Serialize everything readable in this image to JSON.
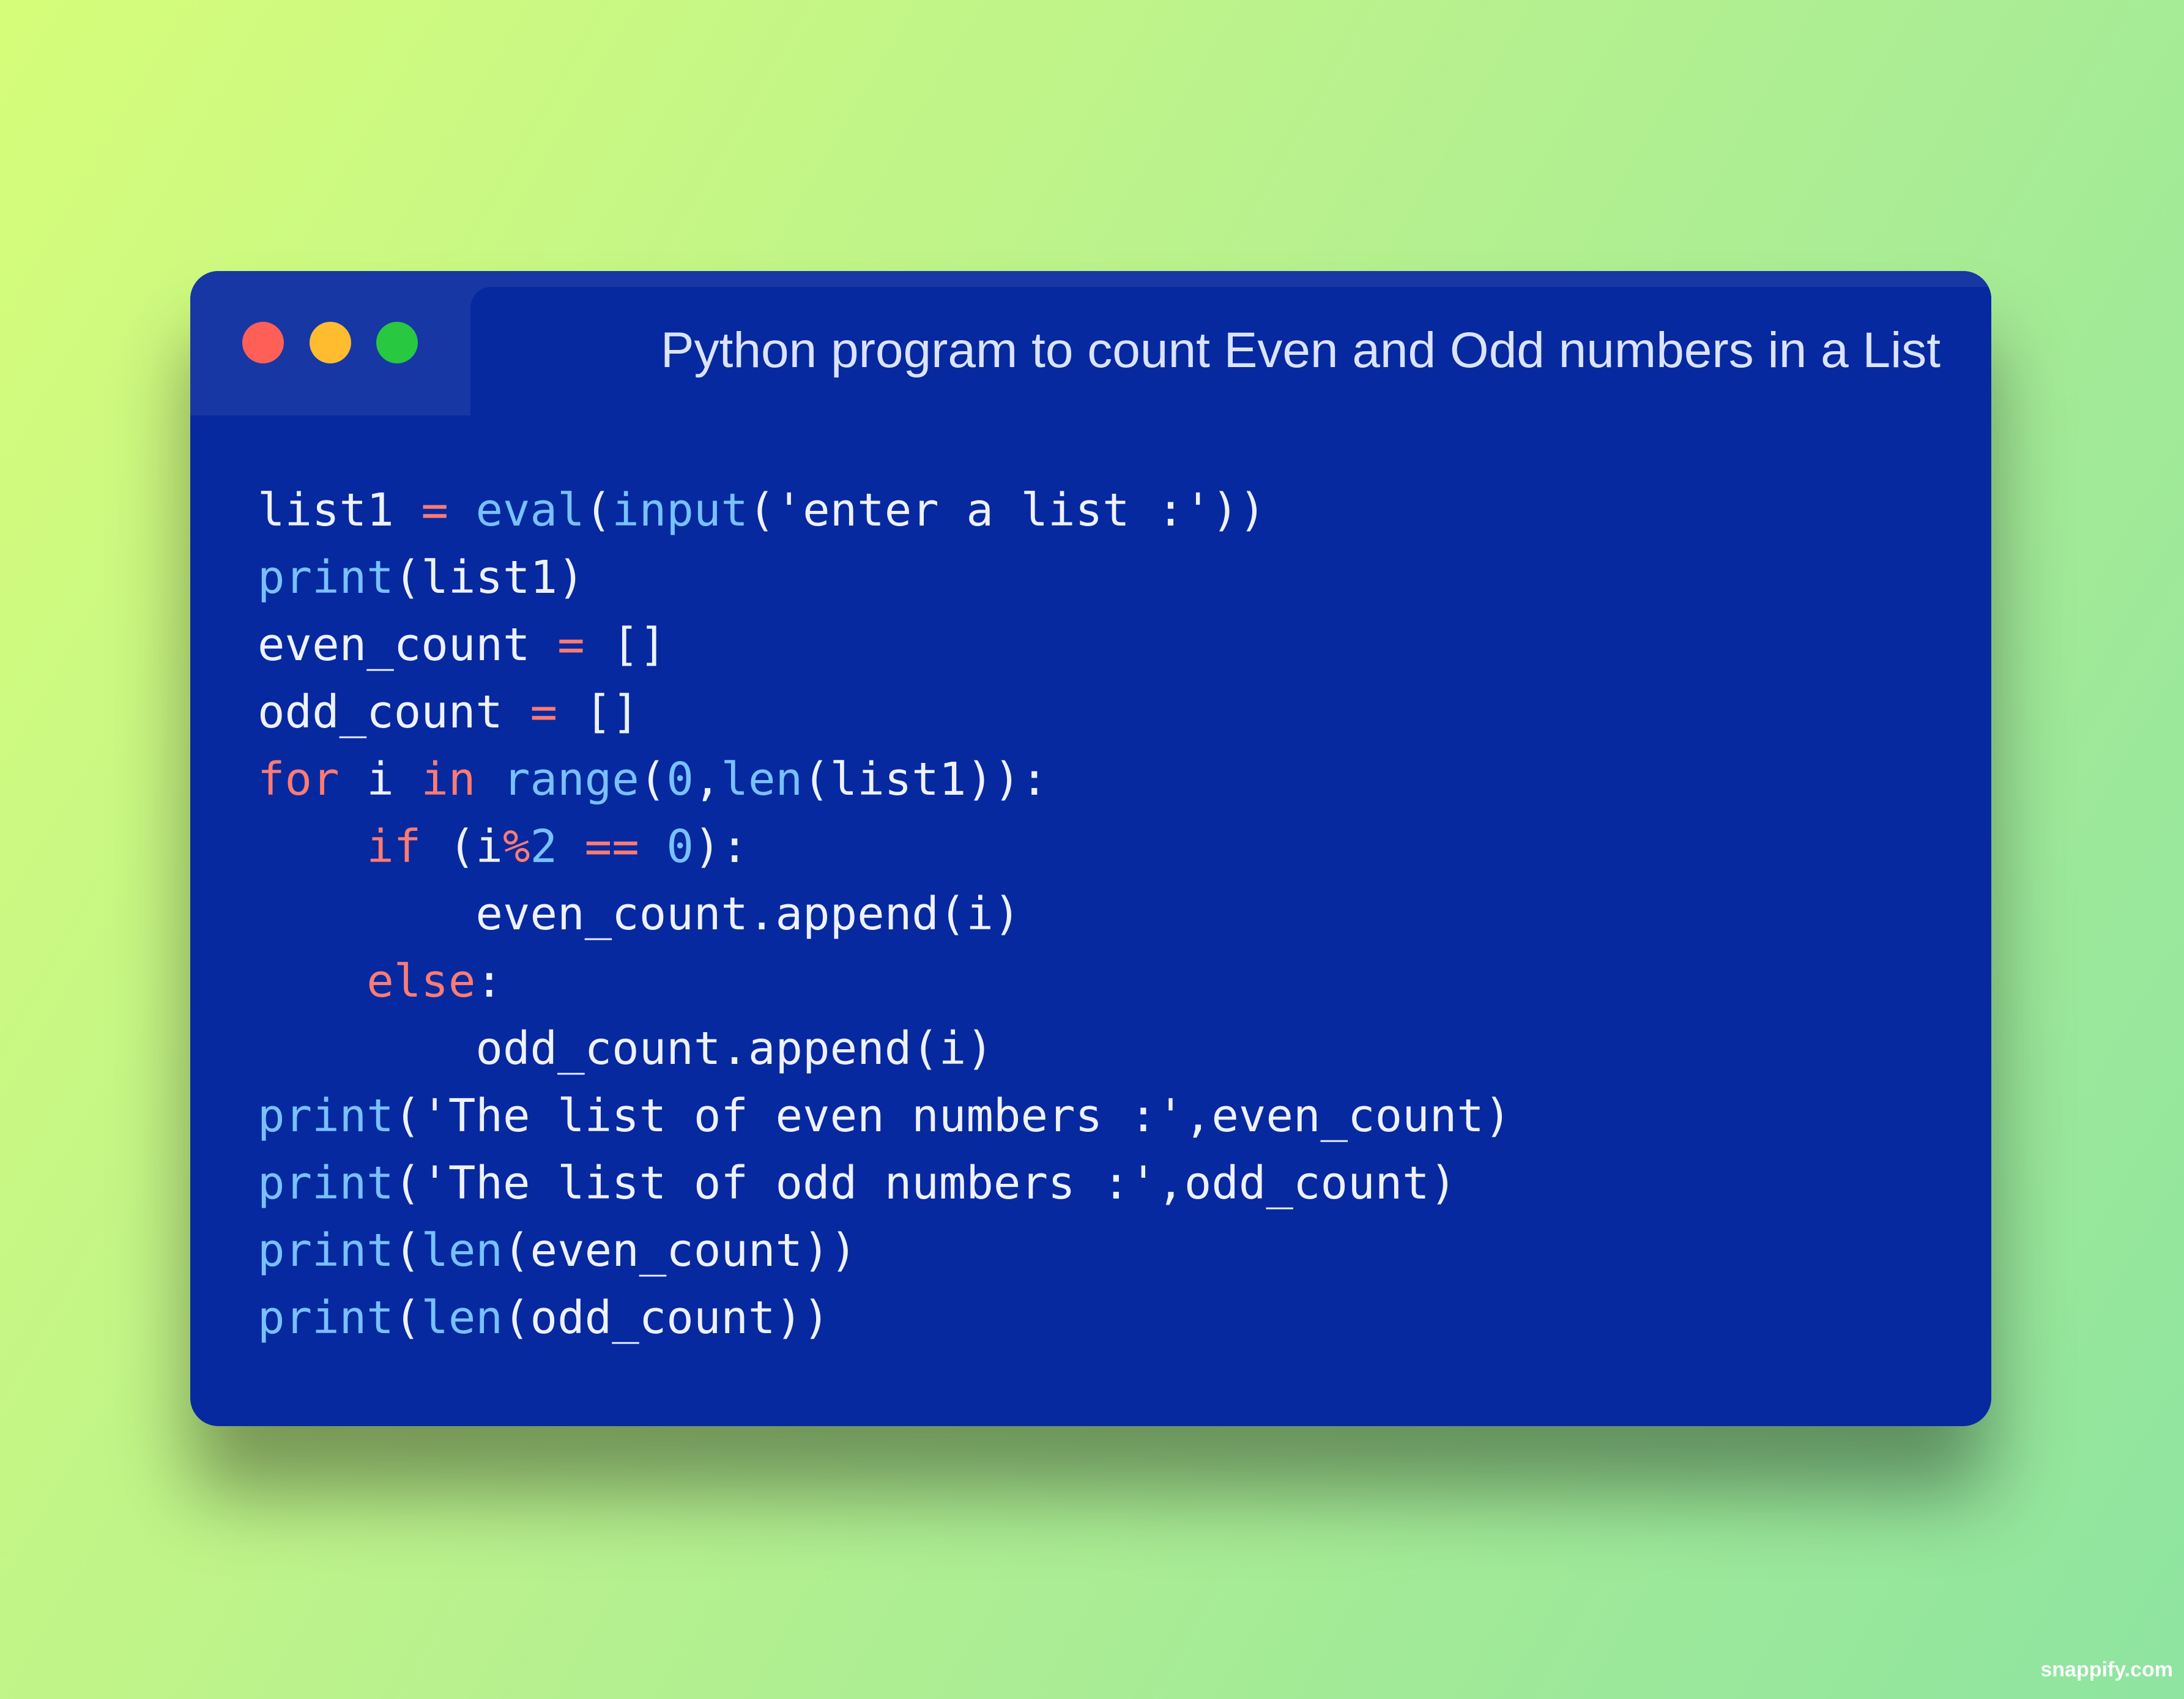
{
  "window": {
    "title": "Python program to count Even and Odd numbers in a List"
  },
  "traffic_lights": {
    "close_color": "#ff5f57",
    "minimize_color": "#febc2e",
    "maximize_color": "#28c840"
  },
  "theme": {
    "background_start": "#d6fd7a",
    "background_end": "#8ee4a0",
    "window_background": "#0629a0",
    "titlebar_background": "#1737a5",
    "builtin_color": "#79c0ff",
    "keyword_color": "#ff7b72",
    "text_color": "#eef1ff"
  },
  "code": {
    "language": "Python",
    "lines": [
      [
        {
          "t": "list1 ",
          "k": "plain"
        },
        {
          "t": "=",
          "k": "op"
        },
        {
          "t": " ",
          "k": "plain"
        },
        {
          "t": "eval",
          "k": "fn"
        },
        {
          "t": "(",
          "k": "plain"
        },
        {
          "t": "input",
          "k": "fn"
        },
        {
          "t": "('enter a list :'))",
          "k": "str"
        }
      ],
      [
        {
          "t": "print",
          "k": "fn"
        },
        {
          "t": "(list1)",
          "k": "plain"
        }
      ],
      [
        {
          "t": "even_count ",
          "k": "plain"
        },
        {
          "t": "=",
          "k": "op"
        },
        {
          "t": " []",
          "k": "plain"
        }
      ],
      [
        {
          "t": "odd_count ",
          "k": "plain"
        },
        {
          "t": "=",
          "k": "op"
        },
        {
          "t": " []",
          "k": "plain"
        }
      ],
      [
        {
          "t": "for",
          "k": "kw"
        },
        {
          "t": " i ",
          "k": "plain"
        },
        {
          "t": "in",
          "k": "kw"
        },
        {
          "t": " ",
          "k": "plain"
        },
        {
          "t": "range",
          "k": "fn"
        },
        {
          "t": "(",
          "k": "plain"
        },
        {
          "t": "0",
          "k": "num"
        },
        {
          "t": ",",
          "k": "plain"
        },
        {
          "t": "len",
          "k": "fn"
        },
        {
          "t": "(list1)):",
          "k": "plain"
        }
      ],
      [
        {
          "t": "    ",
          "k": "plain"
        },
        {
          "t": "if",
          "k": "kw"
        },
        {
          "t": " (i",
          "k": "plain"
        },
        {
          "t": "%",
          "k": "op"
        },
        {
          "t": "2",
          "k": "num"
        },
        {
          "t": " ",
          "k": "plain"
        },
        {
          "t": "==",
          "k": "op"
        },
        {
          "t": " ",
          "k": "plain"
        },
        {
          "t": "0",
          "k": "num"
        },
        {
          "t": "):",
          "k": "plain"
        }
      ],
      [
        {
          "t": "        even_count.append(i)",
          "k": "plain"
        }
      ],
      [
        {
          "t": "    ",
          "k": "plain"
        },
        {
          "t": "else",
          "k": "kw"
        },
        {
          "t": ":",
          "k": "plain"
        }
      ],
      [
        {
          "t": "        odd_count.append(i)",
          "k": "plain"
        }
      ],
      [
        {
          "t": "print",
          "k": "fn"
        },
        {
          "t": "('The list of even numbers :',even_count)",
          "k": "str"
        }
      ],
      [
        {
          "t": "print",
          "k": "fn"
        },
        {
          "t": "('The list of odd numbers :',odd_count)",
          "k": "str"
        }
      ],
      [
        {
          "t": "print",
          "k": "fn"
        },
        {
          "t": "(",
          "k": "plain"
        },
        {
          "t": "len",
          "k": "fn"
        },
        {
          "t": "(even_count))",
          "k": "plain"
        }
      ],
      [
        {
          "t": "print",
          "k": "fn"
        },
        {
          "t": "(",
          "k": "plain"
        },
        {
          "t": "len",
          "k": "fn"
        },
        {
          "t": "(odd_count))",
          "k": "plain"
        }
      ]
    ]
  },
  "watermark": {
    "text": "snappify.com"
  }
}
